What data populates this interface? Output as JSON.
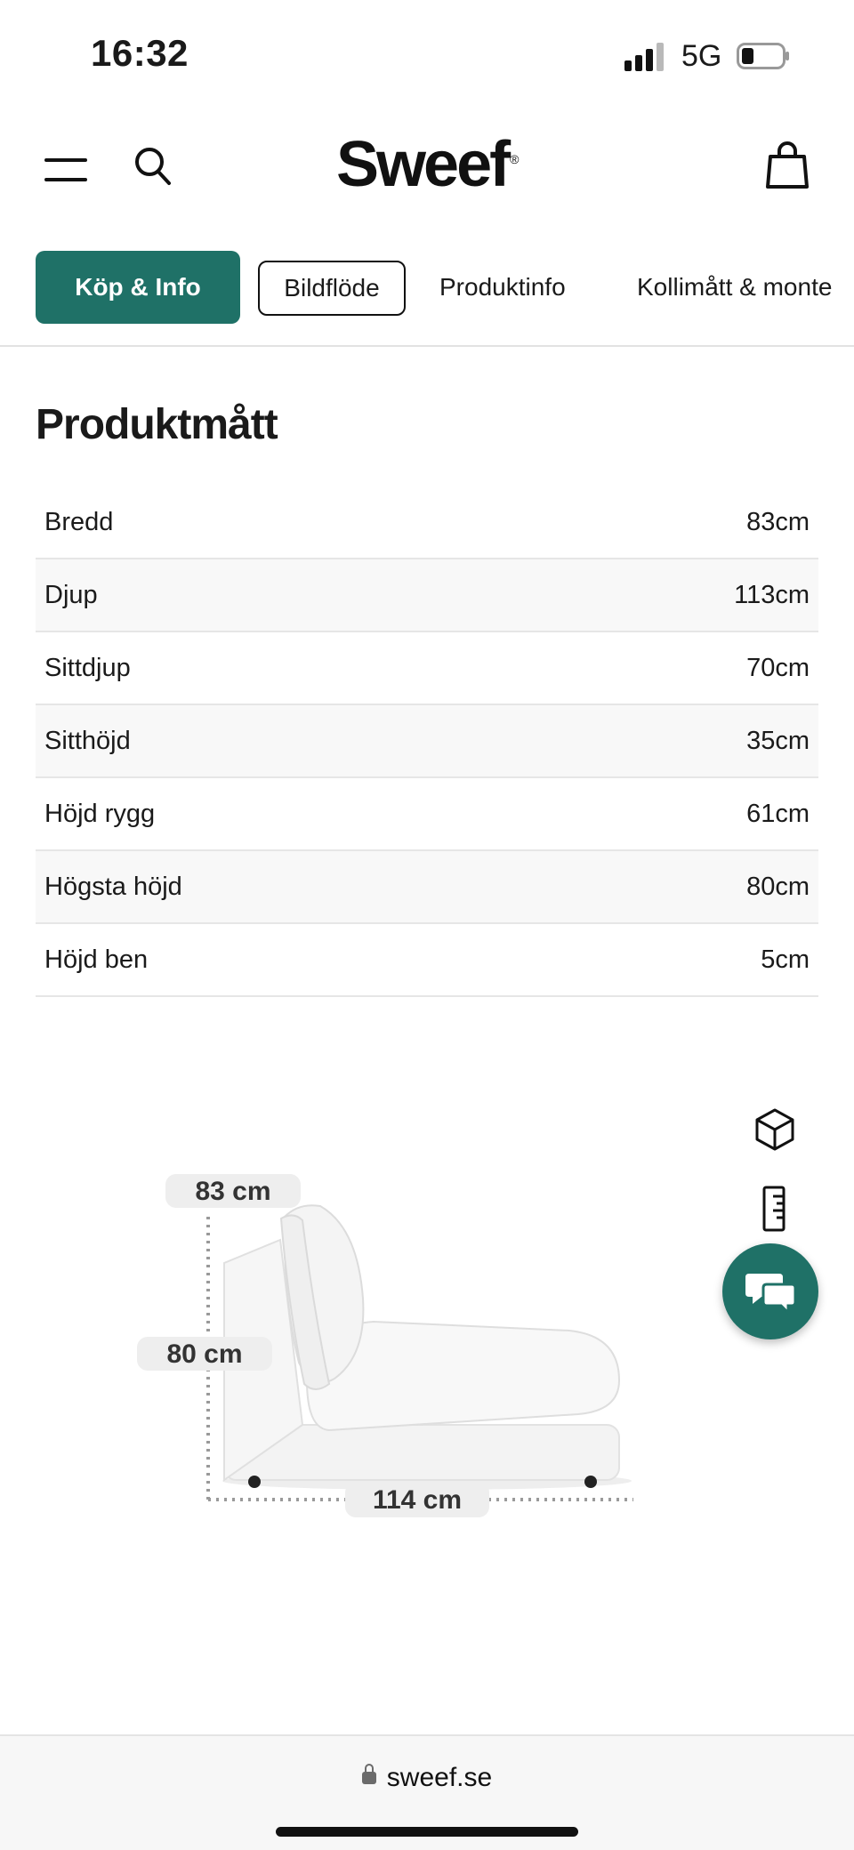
{
  "status_bar": {
    "time": "16:32",
    "network": "5G"
  },
  "header": {
    "logo": "Sweef",
    "logo_mark": "®"
  },
  "tabs": [
    {
      "label": "Köp & Info"
    },
    {
      "label": "Bildflöde"
    },
    {
      "label": "Produktinfo"
    },
    {
      "label": "Kollimått & monte"
    }
  ],
  "dimensions": {
    "title": "Produktmått",
    "rows": [
      {
        "label": "Bredd",
        "value": "83cm"
      },
      {
        "label": "Djup",
        "value": "113cm"
      },
      {
        "label": "Sittdjup",
        "value": "70cm"
      },
      {
        "label": "Sitthöjd",
        "value": "35cm"
      },
      {
        "label": "Höjd rygg",
        "value": "61cm"
      },
      {
        "label": "Högsta höjd",
        "value": "80cm"
      },
      {
        "label": "Höjd ben",
        "value": "5cm"
      }
    ]
  },
  "product_image": {
    "width_label": "83 cm",
    "height_label": "80 cm",
    "depth_label": "114 cm"
  },
  "browser": {
    "url": "sweef.se"
  },
  "colors": {
    "brand": "#1f7167"
  }
}
